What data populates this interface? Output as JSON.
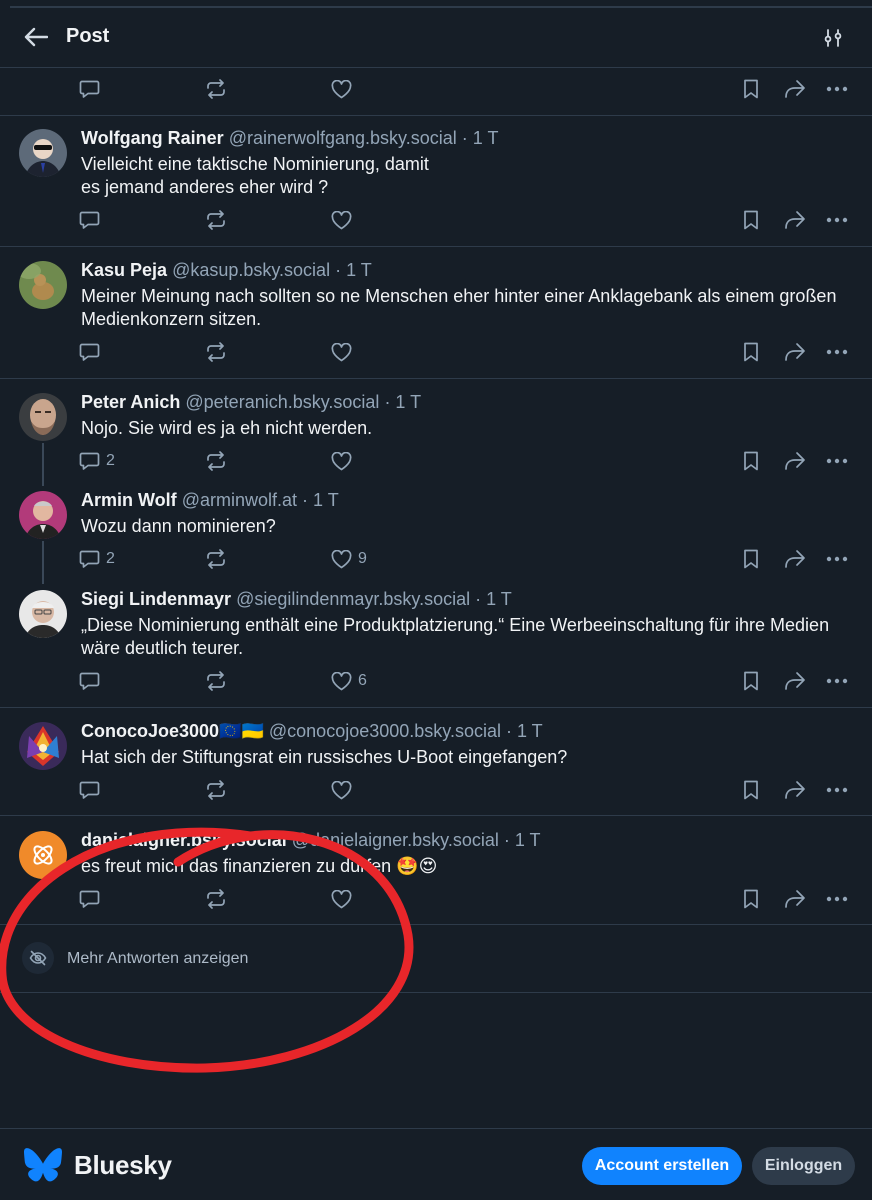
{
  "header": {
    "title": "Post"
  },
  "posts": [
    {
      "name": "Wolfgang Rainer",
      "handle": "@rainerwolfgang.bsky.social",
      "time": "· 1 T",
      "text_lines": [
        "Vielleicht eine taktische Nominierung, damit",
        "es jemand anderes eher wird ?"
      ],
      "reply_count": "",
      "like_count": ""
    },
    {
      "name": "Kasu Peja",
      "handle": "@kasup.bsky.social",
      "time": "· 1 T",
      "text_lines": [
        "Meiner Meinung nach sollten so ne Menschen eher hinter einer Anklagebank als einem großen",
        "Medienkonzern sitzen."
      ],
      "reply_count": "",
      "like_count": ""
    },
    {
      "name": "Peter Anich",
      "handle": "@peteranich.bsky.social",
      "time": "· 1 T",
      "text_lines": [
        "Nojo. Sie wird es ja eh nicht werden."
      ],
      "reply_count": "2",
      "like_count": ""
    },
    {
      "name": "Armin Wolf",
      "handle": "@arminwolf.at",
      "time": "· 1 T",
      "text_lines": [
        "Wozu dann nominieren?"
      ],
      "reply_count": "2",
      "like_count": "9"
    },
    {
      "name": "Siegi Lindenmayr",
      "handle": "@siegilindenmayr.bsky.social",
      "time": "· 1 T",
      "text_lines": [
        "„Diese Nominierung enthält eine Produktplatzierung.“ Eine Werbeeinschaltung für ihre Medien",
        "wäre deutlich teurer."
      ],
      "reply_count": "",
      "like_count": "6"
    },
    {
      "name": "ConocoJoe3000🇪🇺🇺🇦",
      "handle": "@conocojoe3000.bsky.social",
      "time": "· 1 T",
      "text_lines": [
        "Hat sich der Stiftungsrat ein russisches U-Boot eingefangen?"
      ],
      "reply_count": "",
      "like_count": ""
    },
    {
      "name": "danielaigner.bsky.social",
      "handle": "@danielaigner.bsky.social",
      "time": "· 1 T",
      "text_lines": [
        "es freut mich das finanzieren zu dürfen 🤩😍"
      ],
      "reply_count": "",
      "like_count": ""
    }
  ],
  "more_replies": {
    "label": "Mehr Antworten anzeigen"
  },
  "footer": {
    "brand": "Bluesky",
    "signup_label": "Account erstellen",
    "login_label": "Einloggen"
  },
  "colors": {
    "background": "#161e27",
    "divider": "#2e3b4a",
    "muted_text": "#93a5b7",
    "accent": "#1083fe",
    "annotation_red": "#e8262a"
  },
  "icons": [
    "arrow-left-icon",
    "filter-sliders-icon",
    "reply-icon",
    "repost-icon",
    "heart-icon",
    "bookmark-icon",
    "share-icon",
    "more-icon",
    "eye-slash-icon",
    "butterfly-icon"
  ]
}
